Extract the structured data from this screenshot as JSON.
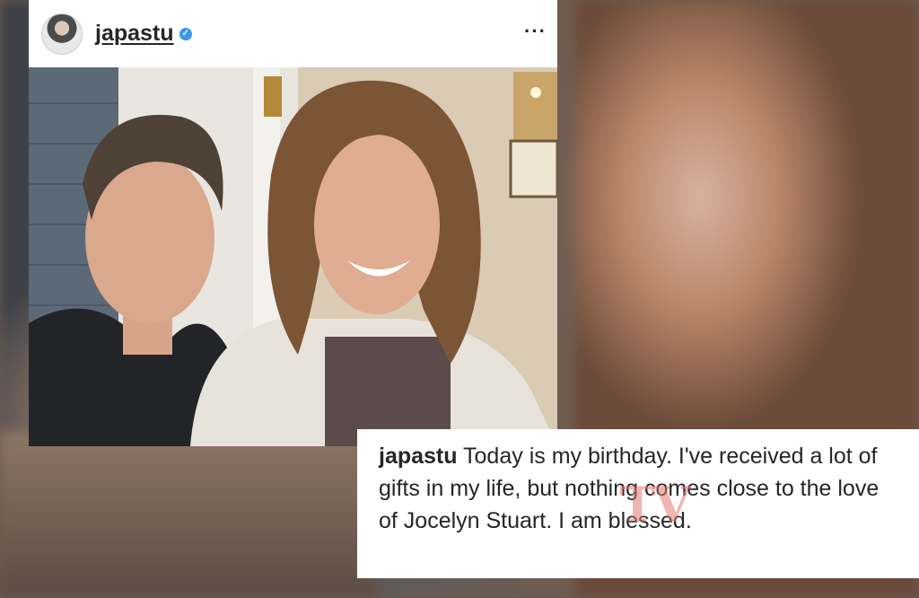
{
  "post": {
    "username": "japastu",
    "more_icon": "more-options-icon",
    "verified_icon": "verified-badge-icon"
  },
  "caption": {
    "username": "japastu",
    "text": "Today is my birthday. I've received a lot of gifts in my life, but nothing comes close to the love of Jocelyn Stuart. I am blessed."
  },
  "watermark": "TV",
  "colors": {
    "verified": "#3897f0",
    "text": "#262626",
    "watermark": "#e1786e"
  }
}
